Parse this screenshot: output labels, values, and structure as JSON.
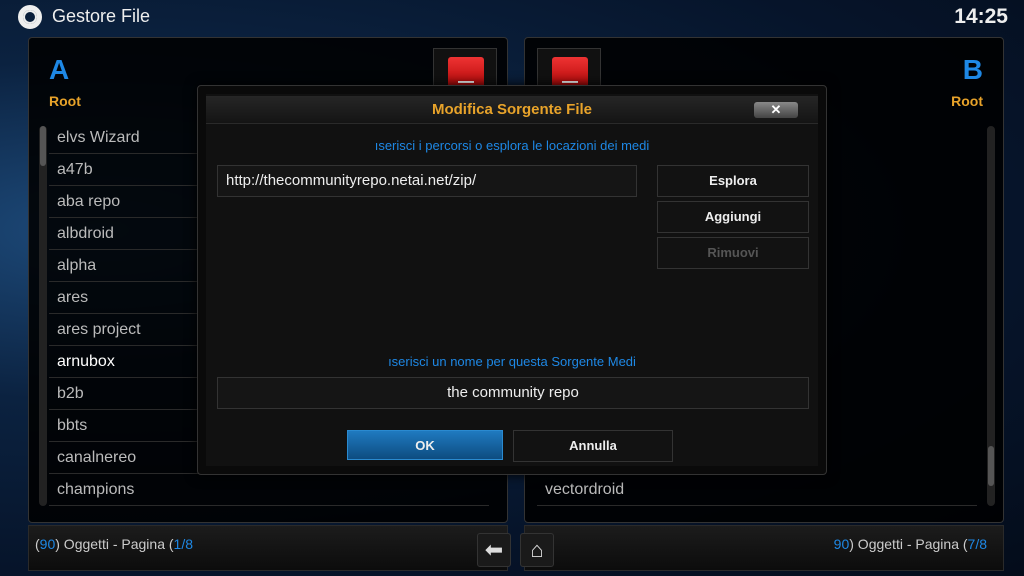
{
  "header": {
    "title": "Gestore File",
    "clock": "14:25",
    "icon": "gear-icon"
  },
  "left": {
    "letter": "A",
    "path": "Root",
    "items": [
      "elvs Wizard",
      "a47b",
      "aba repo",
      "albdroid",
      "alpha",
      "ares",
      "ares project",
      "arnubox",
      "b2b",
      "bbts",
      "canalnereo",
      "champions"
    ],
    "selected": "arnubox",
    "footer": {
      "count": "90",
      "mid": ") Oggetti - Pagina (",
      "page": "1/8",
      "pre": "("
    }
  },
  "right": {
    "letter": "B",
    "path": "Root",
    "items": [
      "vectordroid"
    ],
    "footer": {
      "count": "90",
      "mid": ") Oggetti - Pagina (",
      "page": "7/8"
    }
  },
  "nav": {
    "back": "back-arrow-icon",
    "home": "home-icon"
  },
  "dialog": {
    "title": "Modifica Sorgente File",
    "close": "✕",
    "path_label": "ıserisci i percorsi o esplora le locazioni dei medi",
    "path_value": "http://thecommunityrepo.netai.net/zip/",
    "browse": "Esplora",
    "add": "Aggiungi",
    "remove": "Rimuovi",
    "name_label": "ıserisci un nome per questa Sorgente Medi",
    "name_value": "the community repo",
    "ok": "OK",
    "cancel": "Annulla"
  },
  "colors": {
    "accent": "#1e88e5",
    "title": "#e8a32a",
    "ok": "#1f7ac0"
  }
}
